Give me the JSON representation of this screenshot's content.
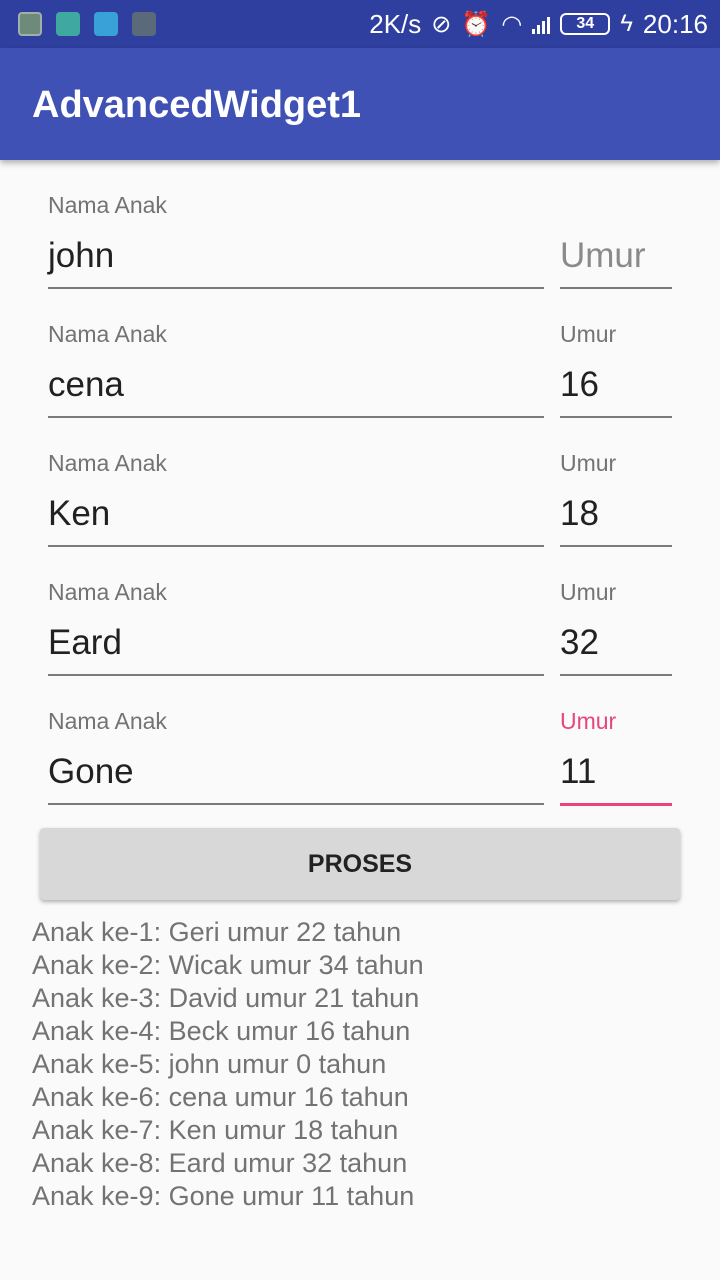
{
  "status_bar": {
    "speed": "2K/s",
    "battery": "34",
    "time": "20:16",
    "icons": [
      "gallery-icon",
      "usb-icon",
      "android-icon",
      "bug-icon",
      "vibrate-off-icon",
      "alarm-icon",
      "wifi-icon",
      "signal-icon",
      "battery-icon",
      "charging-icon"
    ]
  },
  "app_bar": {
    "title": "AdvancedWidget1"
  },
  "form": {
    "rows": [
      {
        "name_label": "Nama Anak",
        "name_value": "john",
        "age_label": "",
        "age_value": "",
        "age_placeholder": "Umur"
      },
      {
        "name_label": "Nama Anak",
        "name_value": "cena",
        "age_label": "Umur",
        "age_value": "16"
      },
      {
        "name_label": "Nama Anak",
        "name_value": "Ken",
        "age_label": "Umur",
        "age_value": "18"
      },
      {
        "name_label": "Nama Anak",
        "name_value": "Eard",
        "age_label": "Umur",
        "age_value": "32"
      },
      {
        "name_label": "Nama Anak",
        "name_value": "Gone",
        "age_label": "Umur",
        "age_value": "11"
      }
    ],
    "focus_color": "#e8457d"
  },
  "button": {
    "label": "PROSES"
  },
  "output": {
    "lines": [
      "Anak ke-1: Geri umur 22 tahun",
      "Anak ke-2: Wicak umur 34 tahun",
      "Anak ke-3: David umur 21 tahun",
      "Anak ke-4: Beck umur 16 tahun",
      "Anak ke-5: john umur 0 tahun",
      "Anak ke-6: cena umur 16 tahun",
      "Anak ke-7: Ken umur 18 tahun",
      "Anak ke-8: Eard umur 32 tahun",
      "Anak ke-9: Gone umur 11 tahun"
    ]
  },
  "colors": {
    "status_bar": "#2f3f9f",
    "app_bar": "#3f51b5",
    "accent": "#e8457d"
  }
}
